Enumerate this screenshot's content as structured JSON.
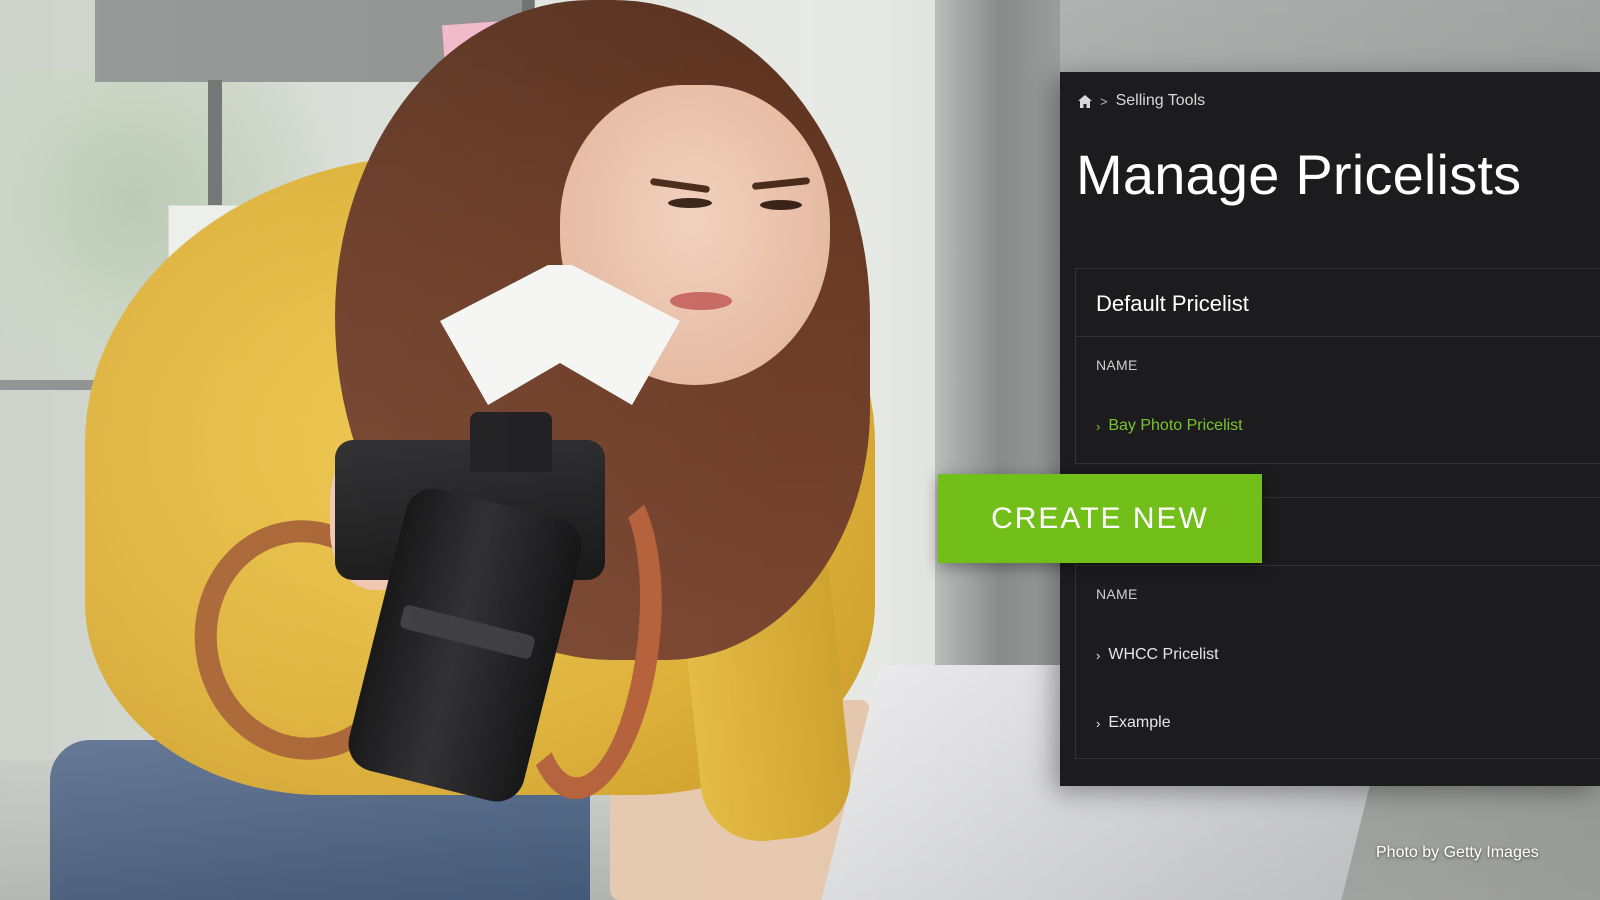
{
  "breadcrumb": {
    "home_icon": "home-icon",
    "separator": ">",
    "current": "Selling Tools"
  },
  "page": {
    "title": "Manage Pricelists"
  },
  "default_pricelist": {
    "header": "Default Pricelist",
    "column_label": "NAME",
    "items": [
      {
        "label": "Bay Photo Pricelist",
        "icon": "chevron-right-icon",
        "state": "active"
      }
    ]
  },
  "other_pricelists": {
    "header": "",
    "column_label": "NAME",
    "items": [
      {
        "label": "WHCC Pricelist",
        "icon": "chevron-right-icon"
      },
      {
        "label": "Example",
        "icon": "chevron-right-icon"
      }
    ]
  },
  "actions": {
    "create_label": "CREATE NEW"
  },
  "photo_credit": "Photo by Getty Images",
  "colors": {
    "panel_bg": "#1c1c1e",
    "accent_green": "#72bf19",
    "link_green": "#7cc42c"
  }
}
